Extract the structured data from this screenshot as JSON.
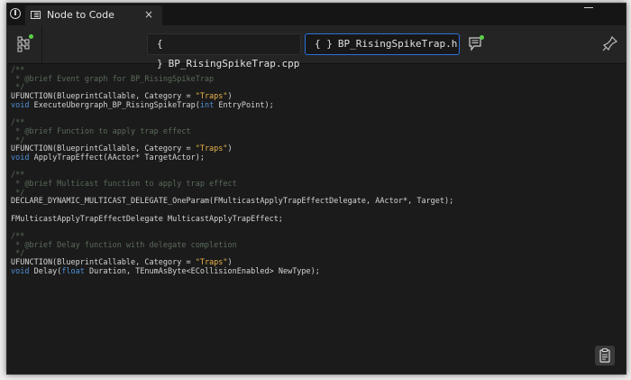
{
  "window": {
    "tab_title": "Node to Code",
    "close_glyph": "×"
  },
  "toolbar": {
    "file_tabs": [
      {
        "label": "BP_RisingSpikeTrap.cpp",
        "active": false
      },
      {
        "label": "BP_RisingSpikeTrap.h",
        "active": true
      }
    ],
    "braces_glyph": "{ }",
    "icons": [
      "graph-toggle-icon",
      "comment-icon",
      "pin-icon",
      "clipboard-icon"
    ],
    "status_dot_color": "#5ed04a",
    "active_tab_border": "#2c71d8"
  },
  "code": {
    "lines": [
      [
        {
          "t": "/**",
          "c": "cm"
        }
      ],
      [
        {
          "t": " * @brief Event graph for BP_RisingSpikeTrap",
          "c": "cm"
        }
      ],
      [
        {
          "t": " */",
          "c": "cm"
        }
      ],
      [
        {
          "t": "UFUNCTION(BlueprintCallable, Category = ",
          "c": ""
        },
        {
          "t": "\"Traps\"",
          "c": "str"
        },
        {
          "t": ")",
          "c": ""
        }
      ],
      [
        {
          "t": "void",
          "c": "kw"
        },
        {
          "t": " ExecuteUbergraph_BP_RisingSpikeTrap(",
          "c": ""
        },
        {
          "t": "int",
          "c": "kw"
        },
        {
          "t": " EntryPoint);",
          "c": ""
        }
      ],
      [
        {
          "t": "",
          "c": ""
        }
      ],
      [
        {
          "t": "/**",
          "c": "cm"
        }
      ],
      [
        {
          "t": " * @brief Function to apply trap effect",
          "c": "cm"
        }
      ],
      [
        {
          "t": " */",
          "c": "cm"
        }
      ],
      [
        {
          "t": "UFUNCTION(BlueprintCallable, Category = ",
          "c": ""
        },
        {
          "t": "\"Traps\"",
          "c": "str"
        },
        {
          "t": ")",
          "c": ""
        }
      ],
      [
        {
          "t": "void",
          "c": "kw"
        },
        {
          "t": " ApplyTrapEffect(AActor* TargetActor);",
          "c": ""
        }
      ],
      [
        {
          "t": "",
          "c": ""
        }
      ],
      [
        {
          "t": "/**",
          "c": "cm"
        }
      ],
      [
        {
          "t": " * @brief Multicast function to apply trap effect",
          "c": "cm"
        }
      ],
      [
        {
          "t": " */",
          "c": "cm"
        }
      ],
      [
        {
          "t": "DECLARE_DYNAMIC_MULTICAST_DELEGATE_OneParam(FMulticastApplyTrapEffectDelegate, AActor*, Target);",
          "c": ""
        }
      ],
      [
        {
          "t": "",
          "c": ""
        }
      ],
      [
        {
          "t": "FMulticastApplyTrapEffectDelegate MulticastApplyTrapEffect;",
          "c": ""
        }
      ],
      [
        {
          "t": "",
          "c": ""
        }
      ],
      [
        {
          "t": "/**",
          "c": "cm"
        }
      ],
      [
        {
          "t": " * @brief Delay function with delegate completion",
          "c": "cm"
        }
      ],
      [
        {
          "t": " */",
          "c": "cm"
        }
      ],
      [
        {
          "t": "UFUNCTION(BlueprintCallable, Category = ",
          "c": ""
        },
        {
          "t": "\"Traps\"",
          "c": "str"
        },
        {
          "t": ")",
          "c": ""
        }
      ],
      [
        {
          "t": "void",
          "c": "kw"
        },
        {
          "t": " Delay(",
          "c": ""
        },
        {
          "t": "float",
          "c": "kw"
        },
        {
          "t": " Duration, TEnumAsByte<ECollisionEnabled> NewType);",
          "c": ""
        }
      ]
    ]
  }
}
